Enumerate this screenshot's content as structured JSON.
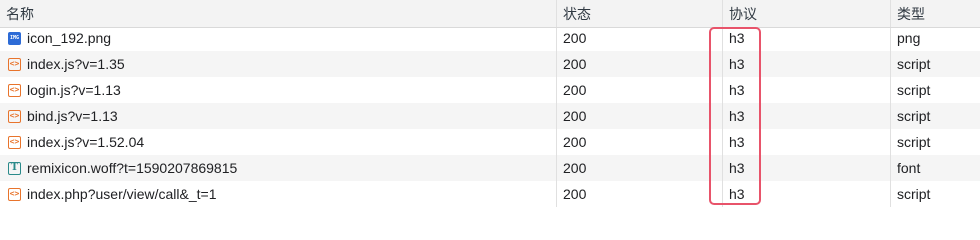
{
  "columns": {
    "name": "名称",
    "status": "状态",
    "protocol": "协议",
    "type": "类型"
  },
  "rows": [
    {
      "name": "icon_192.png",
      "status": "200",
      "protocol": "h3",
      "type": "png",
      "icon": "image-file-icon",
      "icon_glyph": "IMG"
    },
    {
      "name": "index.js?v=1.35",
      "status": "200",
      "protocol": "h3",
      "type": "script",
      "icon": "script-file-icon",
      "icon_glyph": "<>"
    },
    {
      "name": "login.js?v=1.13",
      "status": "200",
      "protocol": "h3",
      "type": "script",
      "icon": "script-file-icon",
      "icon_glyph": "<>"
    },
    {
      "name": "bind.js?v=1.13",
      "status": "200",
      "protocol": "h3",
      "type": "script",
      "icon": "script-file-icon",
      "icon_glyph": "<>"
    },
    {
      "name": "index.js?v=1.52.04",
      "status": "200",
      "protocol": "h3",
      "type": "script",
      "icon": "script-file-icon",
      "icon_glyph": "<>"
    },
    {
      "name": "remixicon.woff?t=1590207869815",
      "status": "200",
      "protocol": "h3",
      "type": "font",
      "icon": "font-file-icon",
      "icon_glyph": "T"
    },
    {
      "name": "index.php?user/view/call&_t=1",
      "status": "200",
      "protocol": "h3",
      "type": "script",
      "icon": "script-file-icon",
      "icon_glyph": "<>"
    }
  ],
  "colors": {
    "highlight_border": "#e8536a",
    "script_icon": "#e8742c",
    "font_icon": "#2a8a8a",
    "image_icon": "#2d6bd6"
  }
}
